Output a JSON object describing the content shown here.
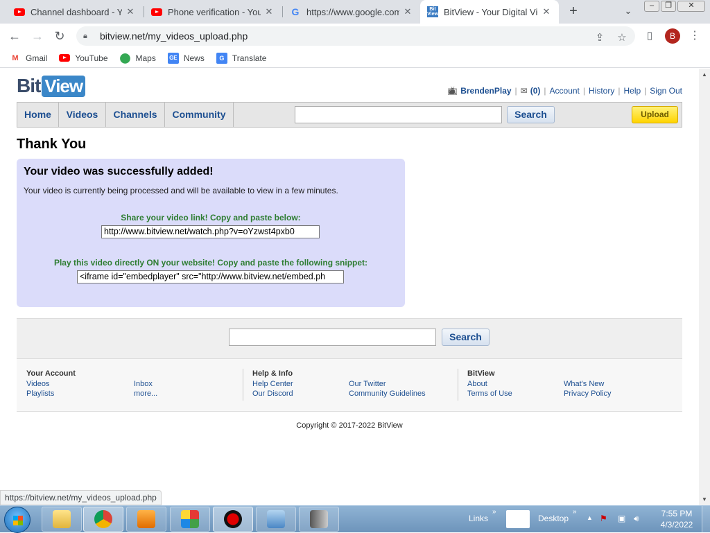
{
  "browser": {
    "tabs": [
      {
        "title": "Channel dashboard - YouTube",
        "favicon": "youtube-icon"
      },
      {
        "title": "Phone verification - YouTube",
        "favicon": "youtube-icon"
      },
      {
        "title": "https://www.google.com/",
        "favicon": "google-icon"
      },
      {
        "title": "BitView - Your Digital Video",
        "favicon": "bitview-icon"
      }
    ],
    "url": "bitview.net/my_videos_upload.php",
    "profile_initial": "B",
    "bookmarks": [
      {
        "label": "Gmail",
        "icon": "gmail-icon"
      },
      {
        "label": "YouTube",
        "icon": "youtube-icon"
      },
      {
        "label": "Maps",
        "icon": "maps-icon"
      },
      {
        "label": "News",
        "icon": "news-icon"
      },
      {
        "label": "Translate",
        "icon": "translate-icon"
      }
    ],
    "status_url": "https://bitview.net/my_videos_upload.php"
  },
  "site": {
    "logo_bit": "Bit",
    "logo_view": "View",
    "user": {
      "name": "BrendenPlay",
      "inbox_count": "(0)",
      "links": [
        "Account",
        "History",
        "Help",
        "Sign Out"
      ]
    },
    "nav": {
      "tabs": [
        "Home",
        "Videos",
        "Channels",
        "Community"
      ],
      "search_label": "Search",
      "upload_label": "Upload"
    },
    "page_title": "Thank You",
    "success": {
      "heading": "Your video was successfully added!",
      "message": "Your video is currently being processed and will be available to view in a few minutes.",
      "share_label": "Share your video link! Copy and paste below:",
      "share_value": "http://www.bitview.net/watch.php?v=oYzwst4pxb0",
      "embed_label": "Play this video directly ON your website! Copy and paste the following snippet:",
      "embed_value": "<iframe id=\"embedplayer\" src=\"http://www.bitview.net/embed.ph"
    },
    "footer_search_label": "Search",
    "footer": {
      "your_account": {
        "heading": "Your Account",
        "col1": [
          "Videos",
          "Playlists"
        ],
        "col2": [
          "Inbox",
          "more..."
        ]
      },
      "help_info": {
        "heading": "Help & Info",
        "col1": [
          "Help Center",
          "Our Discord"
        ],
        "col2": [
          "Our Twitter",
          "Community Guidelines"
        ]
      },
      "bitview": {
        "heading": "BitView",
        "col1": [
          "About",
          "Terms of Use"
        ],
        "col2": [
          "What's New",
          "Privacy Policy"
        ]
      }
    },
    "copyright": "Copyright © 2017-2022 BitView"
  },
  "taskbar": {
    "links_label": "Links",
    "desktop_label": "Desktop",
    "time": "7:55 PM",
    "date": "4/3/2022"
  },
  "colors": {
    "link": "#1d4f91",
    "success_box": "#dbdcfa",
    "success_green": "#2e7d32",
    "upload_yellow": "#ffd400"
  }
}
